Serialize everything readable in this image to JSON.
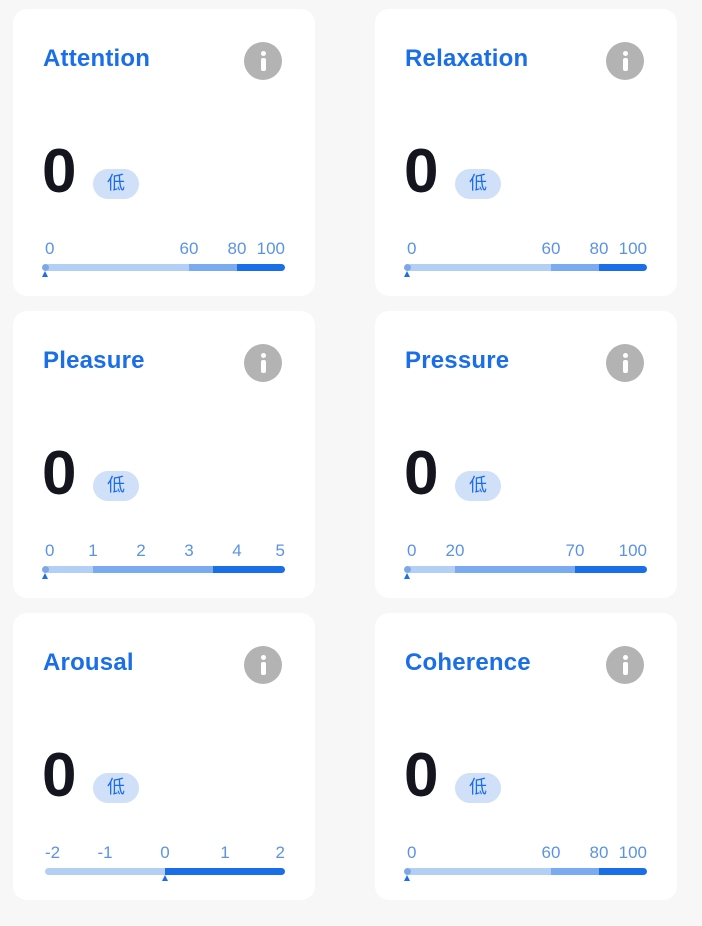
{
  "cards": [
    {
      "title": "Attention",
      "icon": "info-icon",
      "value": "0",
      "level": "低",
      "scale": {
        "min": 0,
        "max": 100
      },
      "ticks": [
        "0",
        "60",
        "80",
        "100"
      ],
      "tick_values": [
        0,
        60,
        80,
        100
      ],
      "segments": [
        {
          "from": 0,
          "to": 60,
          "color": "#b3cff6"
        },
        {
          "from": 60,
          "to": 80,
          "color": "#7aaaf0"
        },
        {
          "from": 80,
          "to": 100,
          "color": "#1a6ee8"
        }
      ],
      "indicator": 0
    },
    {
      "title": "Relaxation",
      "icon": "info-icon",
      "value": "0",
      "level": "低",
      "scale": {
        "min": 0,
        "max": 100
      },
      "ticks": [
        "0",
        "60",
        "80",
        "100"
      ],
      "tick_values": [
        0,
        60,
        80,
        100
      ],
      "segments": [
        {
          "from": 0,
          "to": 60,
          "color": "#b3cff6"
        },
        {
          "from": 60,
          "to": 80,
          "color": "#7aaaf0"
        },
        {
          "from": 80,
          "to": 100,
          "color": "#1a6ee8"
        }
      ],
      "indicator": 0
    },
    {
      "title": "Pleasure",
      "icon": "info-icon",
      "value": "0",
      "level": "低",
      "scale": {
        "min": 0,
        "max": 5
      },
      "ticks": [
        "0",
        "1",
        "2",
        "3",
        "4",
        "5"
      ],
      "tick_values": [
        0,
        1,
        2,
        3,
        4,
        5
      ],
      "segments": [
        {
          "from": 0,
          "to": 1,
          "color": "#b3cff6"
        },
        {
          "from": 1,
          "to": 3.5,
          "color": "#7aaaf0"
        },
        {
          "from": 3.5,
          "to": 5,
          "color": "#1a6ee8"
        }
      ],
      "indicator": 0
    },
    {
      "title": "Pressure",
      "icon": "info-icon",
      "value": "0",
      "level": "低",
      "scale": {
        "min": 0,
        "max": 100
      },
      "ticks": [
        "0",
        "20",
        "70",
        "100"
      ],
      "tick_values": [
        0,
        20,
        70,
        100
      ],
      "segments": [
        {
          "from": 0,
          "to": 20,
          "color": "#b3cff6"
        },
        {
          "from": 20,
          "to": 70,
          "color": "#7aaaf0"
        },
        {
          "from": 70,
          "to": 100,
          "color": "#1a6ee8"
        }
      ],
      "indicator": 0
    },
    {
      "title": "Arousal",
      "icon": "info-icon",
      "value": "0",
      "level": "低",
      "scale": {
        "min": -2,
        "max": 2
      },
      "ticks": [
        "-2",
        "-1",
        "0",
        "1",
        "2"
      ],
      "tick_values": [
        -2,
        -1,
        0,
        1,
        2
      ],
      "segments": [
        {
          "from": -2,
          "to": 0,
          "color": "#b3cff6"
        },
        {
          "from": 0,
          "to": 2,
          "color": "#1a6ee8"
        }
      ],
      "indicator": 0
    },
    {
      "title": "Coherence",
      "icon": "info-icon",
      "value": "0",
      "level": "低",
      "scale": {
        "min": 0,
        "max": 100
      },
      "ticks": [
        "0",
        "60",
        "80",
        "100"
      ],
      "tick_values": [
        0,
        60,
        80,
        100
      ],
      "segments": [
        {
          "from": 0,
          "to": 60,
          "color": "#b3cff6"
        },
        {
          "from": 60,
          "to": 80,
          "color": "#7aaaf0"
        },
        {
          "from": 80,
          "to": 100,
          "color": "#1a6ee8"
        }
      ],
      "indicator": 0
    }
  ],
  "colors": {
    "title": "#1a6ee8",
    "value": "#15151f",
    "tick": "#5b93e3",
    "badge_bg": "#cfe0f8",
    "info_icon": "#b3b3b3",
    "pointer": "#1a6ee8",
    "card_bg": "#ffffff",
    "page_bg": "#f7f7f7"
  }
}
